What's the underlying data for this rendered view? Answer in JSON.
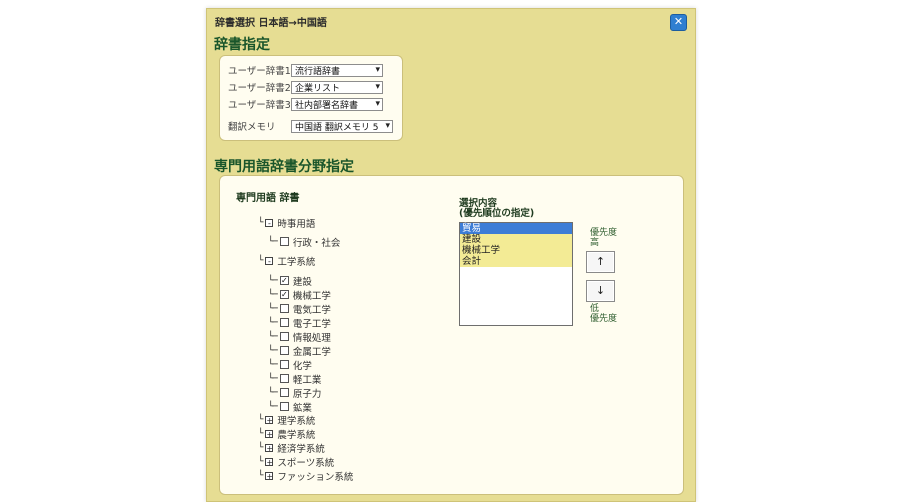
{
  "window": {
    "title": "辞書選択 日本語→中国語"
  },
  "dict_section": {
    "title": "辞書指定",
    "rows": [
      {
        "label": "ユーザー辞書1",
        "value": "流行語辞書"
      },
      {
        "label": "ユーザー辞書2",
        "value": "企業リスト"
      },
      {
        "label": "ユーザー辞書3",
        "value": "社内部署名辞書"
      },
      {
        "label": "翻訳メモリ",
        "value": "中国語 翻訳メモリ 5"
      }
    ]
  },
  "term_section": {
    "title": "専門用語辞書分野指定",
    "tree_title": "専門用語 辞書",
    "tree": [
      {
        "label": "時事用語",
        "type": "group",
        "expander": "-"
      },
      {
        "label": "行政・社会",
        "type": "leaf",
        "checked": false
      },
      {
        "label": "工学系統",
        "type": "group",
        "expander": "-"
      },
      {
        "label": "建設",
        "type": "leaf",
        "checked": true
      },
      {
        "label": "機械工学",
        "type": "leaf",
        "checked": true
      },
      {
        "label": "電気工学",
        "type": "leaf",
        "checked": false
      },
      {
        "label": "電子工学",
        "type": "leaf",
        "checked": false
      },
      {
        "label": "情報処理",
        "type": "leaf",
        "checked": false
      },
      {
        "label": "金属工学",
        "type": "leaf",
        "checked": false
      },
      {
        "label": "化学",
        "type": "leaf",
        "checked": false
      },
      {
        "label": "軽工業",
        "type": "leaf",
        "checked": false
      },
      {
        "label": "原子力",
        "type": "leaf",
        "checked": false
      },
      {
        "label": "鉱業",
        "type": "leaf",
        "checked": false
      },
      {
        "label": "理学系統",
        "type": "group",
        "expander": "+"
      },
      {
        "label": "農学系統",
        "type": "group",
        "expander": "+"
      },
      {
        "label": "経済学系統",
        "type": "group",
        "expander": "+"
      },
      {
        "label": "スポーツ系統",
        "type": "group",
        "expander": "+"
      },
      {
        "label": "ファッション系統",
        "type": "group",
        "expander": "+"
      }
    ],
    "selection": {
      "title_line1": "選択内容",
      "title_line2": "(優先順位の指定)",
      "items": [
        "貿易",
        "建設",
        "機械工学",
        "会計"
      ],
      "selected_index": 0
    },
    "priority": {
      "high_line1": "優先度",
      "high_line2": "高",
      "low_line1": "低",
      "low_line2": "優先度",
      "up_label": "↑",
      "down_label": "↓"
    }
  },
  "colors": {
    "window_bg": "#e6dd93",
    "panel_bg": "#fffdf0",
    "section_title": "#19552a",
    "selected": "#3d7dd6",
    "highlight": "#f3eb95"
  }
}
